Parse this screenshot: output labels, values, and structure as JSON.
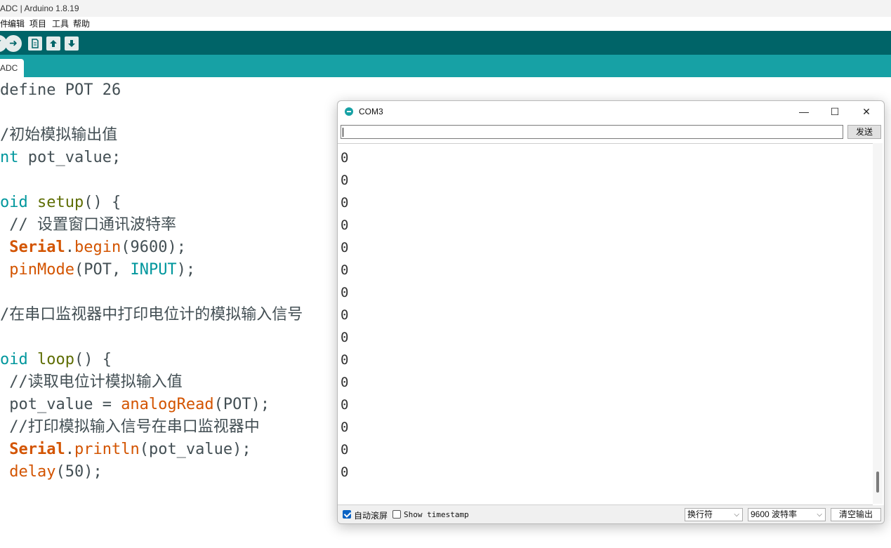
{
  "window": {
    "title": "ADC | Arduino 1.8.19"
  },
  "menu": {
    "items": [
      {
        "label": "件"
      },
      {
        "label": "编辑"
      },
      {
        "label": "项目"
      },
      {
        "label": "工具"
      },
      {
        "label": "帮助"
      }
    ]
  },
  "toolbar": {
    "verify_icon": "check-icon",
    "upload_icon": "arrow-right-icon",
    "new_icon": "new-file-icon",
    "open_icon": "open-icon",
    "save_icon": "save-icon"
  },
  "tabs": [
    {
      "label": "ADC"
    }
  ],
  "editor": {
    "lines": [
      {
        "parts": [
          {
            "t": "define POT 26",
            "c": ""
          }
        ]
      },
      {
        "parts": [
          {
            "t": "",
            "c": ""
          }
        ]
      },
      {
        "parts": [
          {
            "t": "/初始模拟输出值",
            "c": "cmt"
          }
        ]
      },
      {
        "parts": [
          {
            "t": "nt",
            "c": "kw-type"
          },
          {
            "t": " pot_value;",
            "c": ""
          }
        ]
      },
      {
        "parts": [
          {
            "t": "",
            "c": ""
          }
        ]
      },
      {
        "parts": [
          {
            "t": "oid",
            "c": "kw-type"
          },
          {
            "t": " ",
            "c": ""
          },
          {
            "t": "setup",
            "c": "kw-block"
          },
          {
            "t": "() {",
            "c": ""
          }
        ]
      },
      {
        "parts": [
          {
            "t": " // 设置窗口通讯波特率",
            "c": "cmt"
          }
        ]
      },
      {
        "parts": [
          {
            "t": " ",
            "c": ""
          },
          {
            "t": "Serial",
            "c": "kw-class"
          },
          {
            "t": ".",
            "c": ""
          },
          {
            "t": "begin",
            "c": "kw-func"
          },
          {
            "t": "(9600);",
            "c": ""
          }
        ]
      },
      {
        "parts": [
          {
            "t": " ",
            "c": ""
          },
          {
            "t": "pinMode",
            "c": "kw-func"
          },
          {
            "t": "(POT, ",
            "c": ""
          },
          {
            "t": "INPUT",
            "c": "kw-const"
          },
          {
            "t": ");",
            "c": ""
          }
        ]
      },
      {
        "parts": [
          {
            "t": "",
            "c": ""
          }
        ]
      },
      {
        "parts": [
          {
            "t": "/在串口监视器中打印电位计的模拟输入信号",
            "c": "cmt"
          }
        ]
      },
      {
        "parts": [
          {
            "t": "",
            "c": ""
          }
        ]
      },
      {
        "parts": [
          {
            "t": "oid",
            "c": "kw-type"
          },
          {
            "t": " ",
            "c": ""
          },
          {
            "t": "loop",
            "c": "kw-block"
          },
          {
            "t": "() {",
            "c": ""
          }
        ]
      },
      {
        "parts": [
          {
            "t": " //读取电位计模拟输入值",
            "c": "cmt"
          }
        ]
      },
      {
        "parts": [
          {
            "t": " pot_value = ",
            "c": ""
          },
          {
            "t": "analogRead",
            "c": "kw-func"
          },
          {
            "t": "(POT);",
            "c": ""
          }
        ]
      },
      {
        "parts": [
          {
            "t": " //打印模拟输入信号在串口监视器中",
            "c": "cmt"
          }
        ]
      },
      {
        "parts": [
          {
            "t": " ",
            "c": ""
          },
          {
            "t": "Serial",
            "c": "kw-class"
          },
          {
            "t": ".",
            "c": ""
          },
          {
            "t": "println",
            "c": "kw-func"
          },
          {
            "t": "(pot_value);",
            "c": ""
          }
        ]
      },
      {
        "parts": [
          {
            "t": " ",
            "c": ""
          },
          {
            "t": "delay",
            "c": "kw-func"
          },
          {
            "t": "(50);",
            "c": ""
          }
        ]
      }
    ]
  },
  "monitor": {
    "title": "COM3",
    "input_value": "",
    "send_label": "发送",
    "output": [
      "0",
      "0",
      "0",
      "0",
      "0",
      "0",
      "0",
      "0",
      "0",
      "0",
      "0",
      "0",
      "0",
      "0",
      "0"
    ],
    "autoscroll_label": "自动滚屏",
    "autoscroll_checked": true,
    "timestamp_label": "Show timestamp",
    "timestamp_checked": false,
    "line_ending": "换行符",
    "baud": "9600 波特率",
    "clear_label": "清空输出",
    "minimize_icon": "minimize-icon",
    "maximize_icon": "maximize-icon",
    "close_icon": "close-icon"
  }
}
